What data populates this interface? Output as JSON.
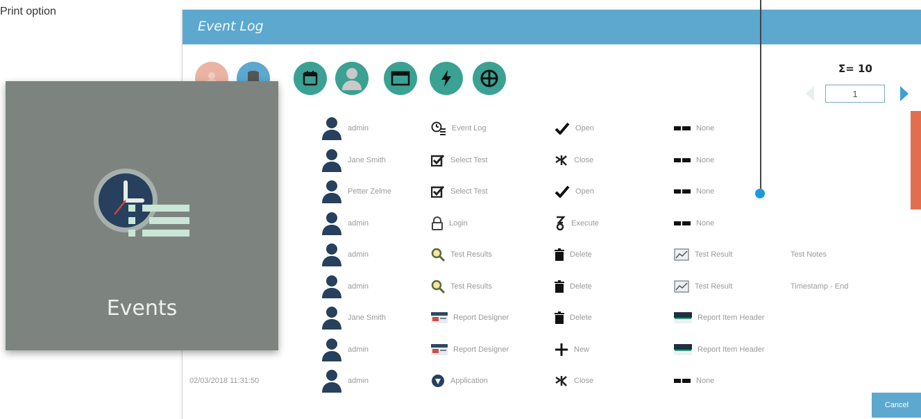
{
  "callout": {
    "label": "Print option"
  },
  "window": {
    "title": "Event Log",
    "toolbar_icons": [
      "person-icon",
      "database-icon",
      "calendar-icon",
      "user-icon",
      "window-icon",
      "lightning-icon",
      "target-icon"
    ],
    "sigma_label": "Σ= 10",
    "page_value": "1",
    "cancel_label": "Cancel"
  },
  "rows": [
    {
      "timestamp": "",
      "user": "admin",
      "module": "Event Log",
      "module_icon": "clock-list-icon",
      "action": "Open",
      "action_icon": "check-icon",
      "object": "None",
      "object_icon": "dash-icon",
      "detail": ""
    },
    {
      "timestamp": "",
      "user": "Jane Smith",
      "module": "Select Test",
      "module_icon": "checkbox-icon",
      "action": "Close",
      "action_icon": "close-arrow-icon",
      "object": "None",
      "object_icon": "dash-icon",
      "detail": ""
    },
    {
      "timestamp": "",
      "user": "Petter Zelme",
      "module": "Select Test",
      "module_icon": "checkbox-icon",
      "action": "Open",
      "action_icon": "check-icon",
      "object": "None",
      "object_icon": "dash-icon",
      "detail": ""
    },
    {
      "timestamp": "",
      "user": "admin",
      "module": "Login",
      "module_icon": "lock-icon",
      "action": "Execute",
      "action_icon": "execute-icon",
      "object": "None",
      "object_icon": "dash-icon",
      "detail": ""
    },
    {
      "timestamp": "",
      "user": "admin",
      "module": "Test Results",
      "module_icon": "magnifier-icon",
      "action": "Delete",
      "action_icon": "trash-icon",
      "object": "Test Result",
      "object_icon": "chart-icon",
      "detail": "Test Notes"
    },
    {
      "timestamp": "",
      "user": "admin",
      "module": "Test Results",
      "module_icon": "magnifier-icon",
      "action": "Delete",
      "action_icon": "trash-icon",
      "object": "Test Result",
      "object_icon": "chart-icon",
      "detail": "Timestamp - End"
    },
    {
      "timestamp": "",
      "user": "Jane Smith",
      "module": "Report Designer",
      "module_icon": "report-icon",
      "action": "Delete",
      "action_icon": "trash-icon",
      "object": "Report Item Header",
      "object_icon": "header-icon",
      "detail": ""
    },
    {
      "timestamp": "",
      "user": "admin",
      "module": "Report Designer",
      "module_icon": "report-icon",
      "action": "New",
      "action_icon": "plus-icon",
      "object": "Report Item Header",
      "object_icon": "header-icon",
      "detail": ""
    },
    {
      "timestamp": "02/03/2018 11:31:50",
      "user": "admin",
      "module": "Application",
      "module_icon": "app-shield-icon",
      "action": "Close",
      "action_icon": "close-arrow-icon",
      "object": "None",
      "object_icon": "dash-icon",
      "detail": ""
    }
  ],
  "overlay": {
    "label": "Events",
    "icon": "events-clock-icon"
  },
  "colors": {
    "titlebar": "#5ca8cf",
    "toolbar_teal": "#3aa193",
    "scroll_accent": "#e36e4e",
    "overlay_bg": "#7d847f",
    "leader_dot": "#1a9bd7"
  }
}
